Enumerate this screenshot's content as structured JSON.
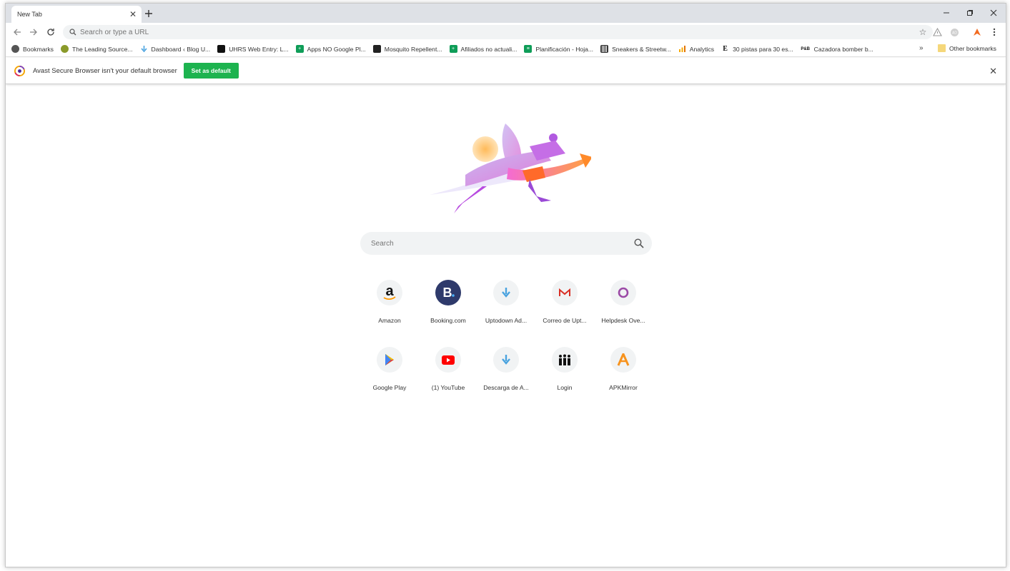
{
  "browser": {
    "tab": {
      "title": "New Tab"
    },
    "omnibox": {
      "placeholder": "Search or type a URL"
    },
    "bookmarks": [
      {
        "label": "Bookmarks",
        "icon": "globe-icon",
        "color": "#555555"
      },
      {
        "label": "The Leading Source...",
        "icon": "leaf-icon",
        "color": "#8a9a2a"
      },
      {
        "label": "Dashboard ‹ Blog U...",
        "icon": "uptodown-icon",
        "color": "#4aa3df"
      },
      {
        "label": "UHRS Web Entry: L...",
        "icon": "people-icon",
        "color": "#111111"
      },
      {
        "label": "Apps NO Google Pl...",
        "icon": "sheets-icon",
        "color": "#0f9d58"
      },
      {
        "label": "Mosquito Repellent...",
        "icon": "doc-icon",
        "color": "#222222"
      },
      {
        "label": "Afiliados no actuali...",
        "icon": "sheets-icon",
        "color": "#0f9d58"
      },
      {
        "label": "Planificación - Hoja...",
        "icon": "sheets-icon",
        "color": "#0f9d58"
      },
      {
        "label": "Sneakers & Streetw...",
        "icon": "barcode-icon",
        "color": "#333333"
      },
      {
        "label": "Analytics",
        "icon": "analytics-icon",
        "color": "#f9ab00"
      },
      {
        "label": "30 pistas para 30 es...",
        "icon": "e-icon",
        "color": "#111111"
      },
      {
        "label": "Cazadora bomber b...",
        "icon": "pb-icon",
        "color": "#111111"
      }
    ],
    "bookmarks_more": "»",
    "other_bookmarks": "Other bookmarks"
  },
  "infobar": {
    "message": "Avast Secure Browser isn't your default browser",
    "button": "Set as default"
  },
  "newtab": {
    "search_placeholder": "Search",
    "tiles": [
      {
        "label": "Amazon",
        "icon": "amazon-icon"
      },
      {
        "label": "Booking.com",
        "icon": "booking-icon"
      },
      {
        "label": "Uptodown Ad...",
        "icon": "uptodown-icon"
      },
      {
        "label": "Correo de Upt...",
        "icon": "gmail-icon"
      },
      {
        "label": "Helpdesk Ove...",
        "icon": "helpdesk-icon"
      },
      {
        "label": "Google Play",
        "icon": "google-play-icon"
      },
      {
        "label": "(1) YouTube",
        "icon": "youtube-icon"
      },
      {
        "label": "Descarga de A...",
        "icon": "uptodown-icon"
      },
      {
        "label": "Login",
        "icon": "people-icon"
      },
      {
        "label": "APKMirror",
        "icon": "apkmirror-icon"
      }
    ]
  },
  "colors": {
    "accent_green": "#1db34f",
    "titlebar": "#dee1e6",
    "omnibox": "#f1f3f4"
  }
}
